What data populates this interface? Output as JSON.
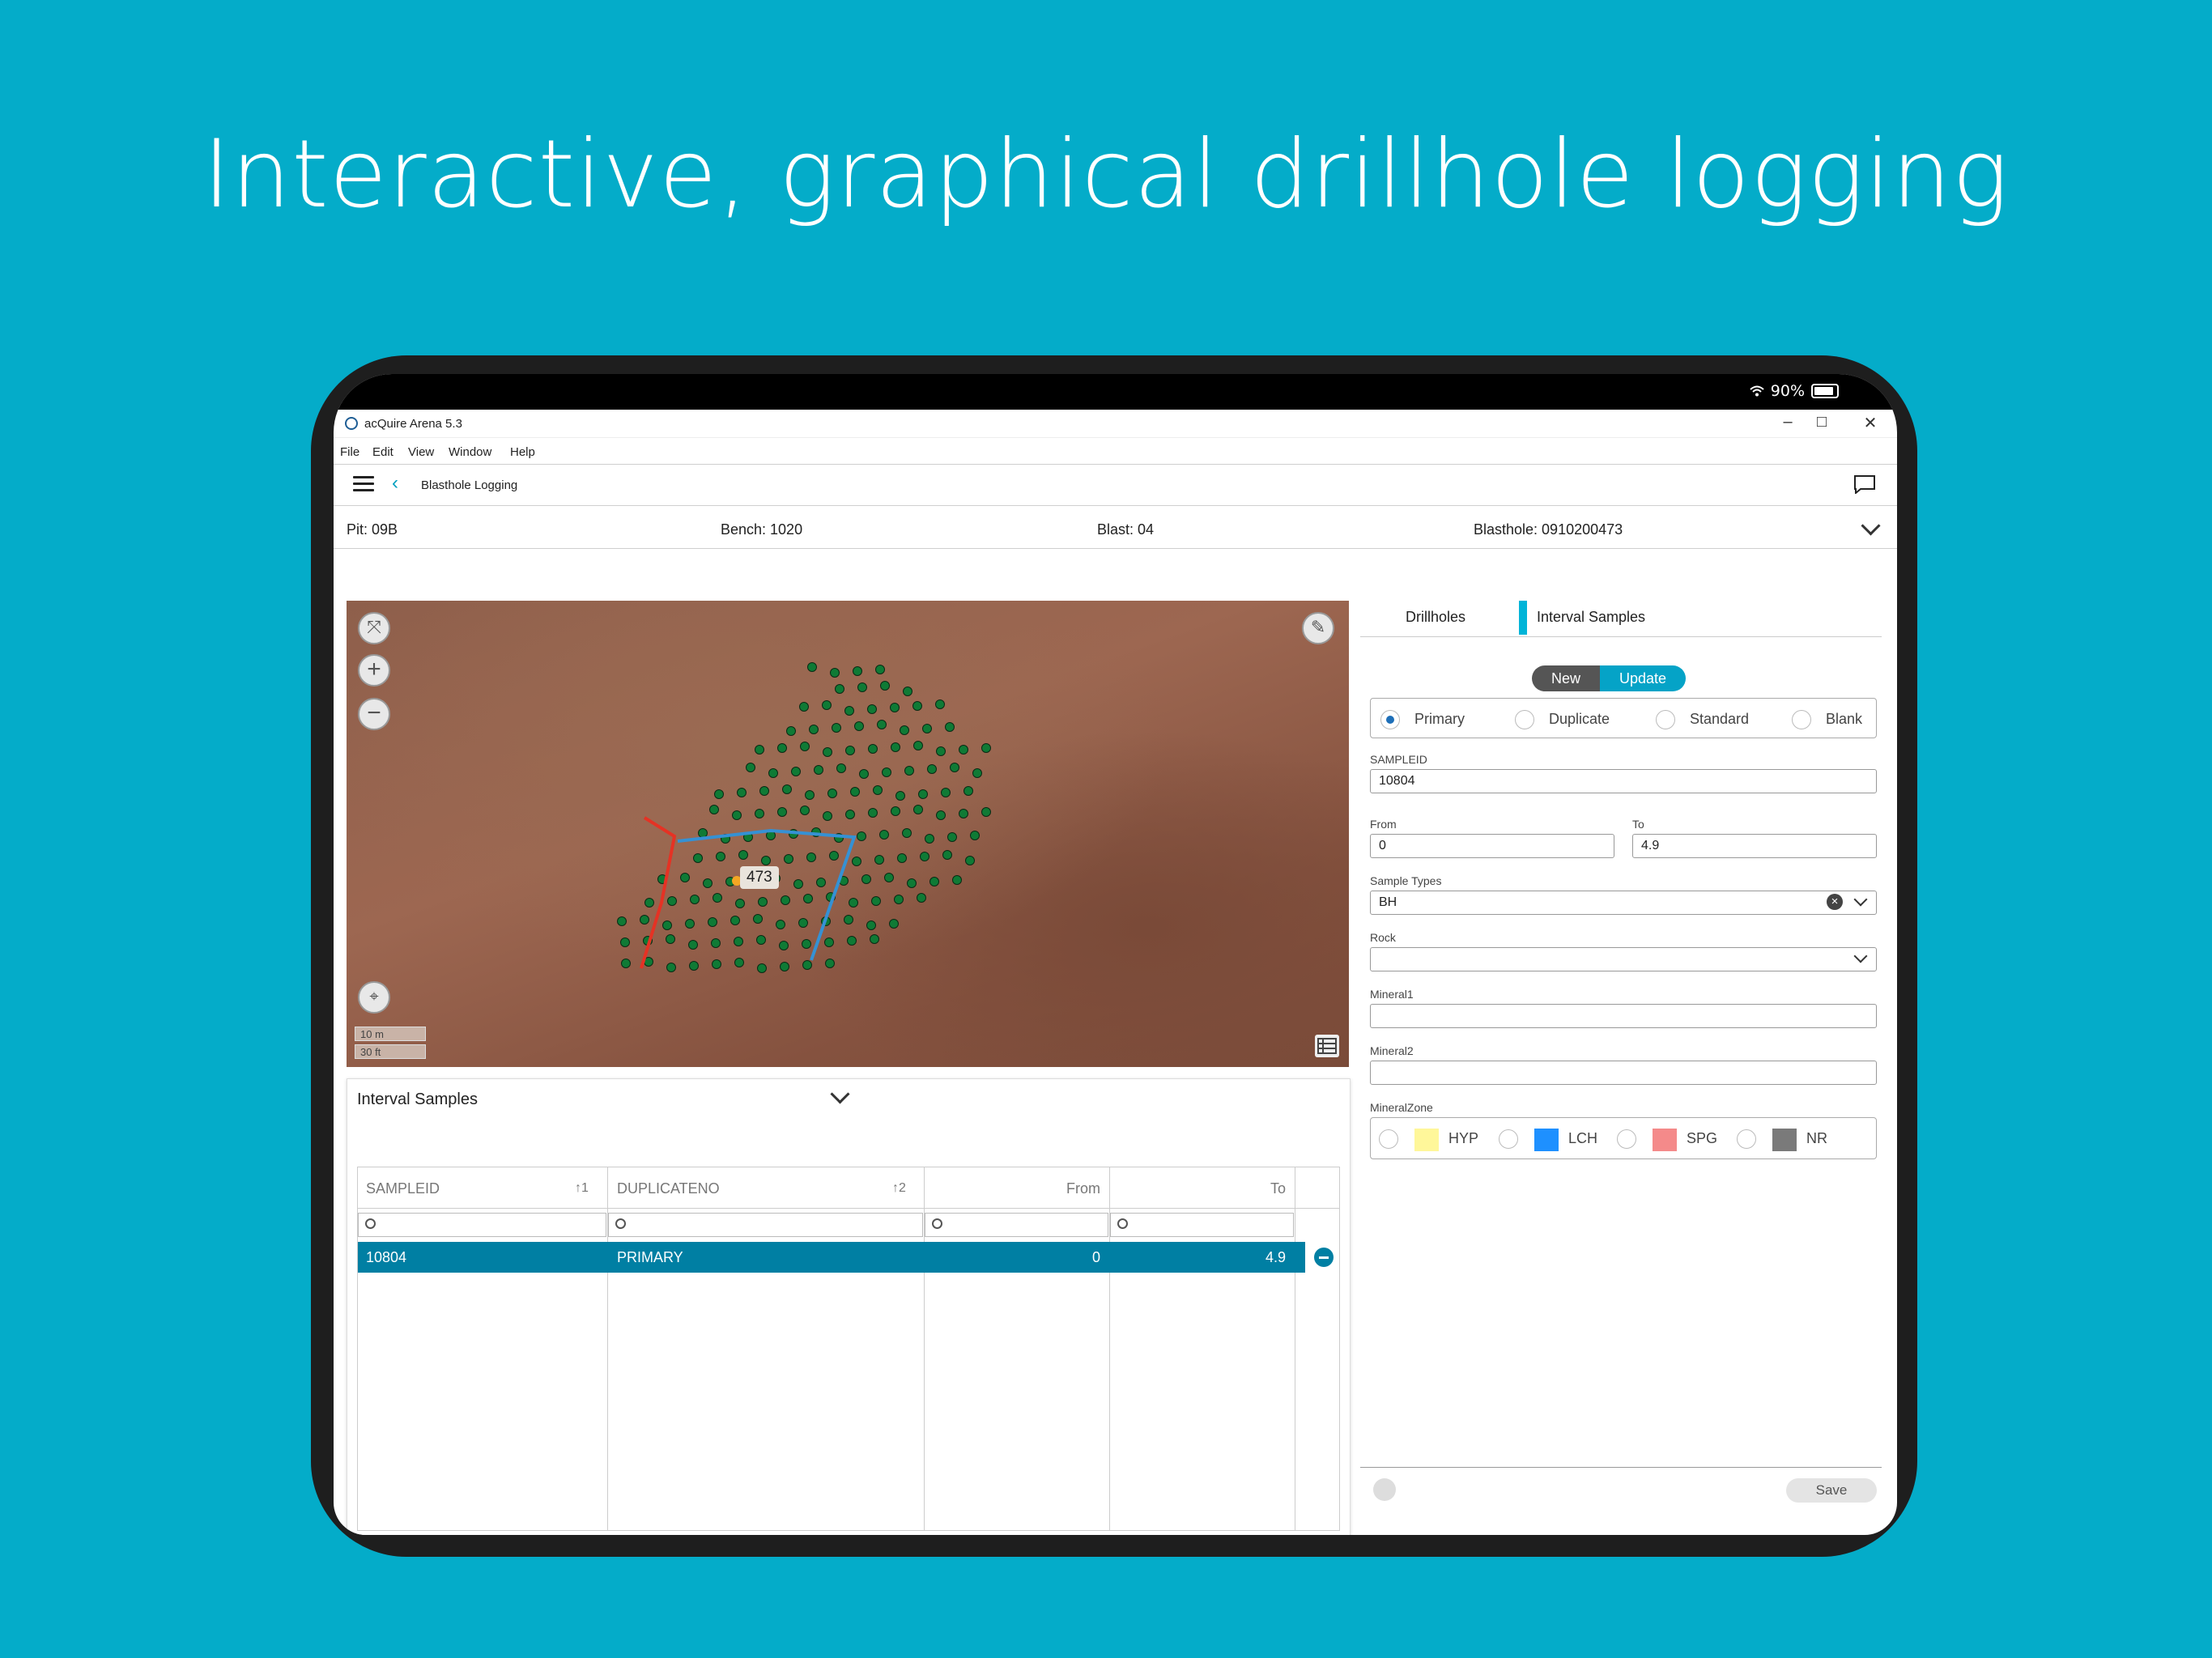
{
  "headline": "Interactive, graphical drillhole logging",
  "device": {
    "battery": "90%"
  },
  "window": {
    "title": "acQuire Arena 5.3",
    "minimize": "–",
    "maximize": "□",
    "close": "✕"
  },
  "menu": {
    "file": "File",
    "edit": "Edit",
    "view": "View",
    "window": "Window",
    "help": "Help"
  },
  "nav": {
    "back": "‹",
    "title": "Blasthole Logging"
  },
  "info": {
    "pit": "Pit: 09B",
    "bench": "Bench: 1020",
    "blast": "Blast: 04",
    "blasthole": "Blasthole: 0910200473"
  },
  "map": {
    "selected_label": "473",
    "scale_m": "10 m",
    "scale_ft": "30 ft",
    "hole_color": "#0f7a35",
    "selected_color": "#f5a623",
    "line_colors": {
      "red": "#e53224",
      "blue": "#3591d4"
    }
  },
  "samples_panel": {
    "title": "Interval Samples",
    "columns": {
      "sampleid": "SAMPLEID",
      "sampleid_sort": "↑1",
      "duplicateno": "DUPLICATENO",
      "duplicateno_sort": "↑2",
      "from": "From",
      "to": "To"
    },
    "row": {
      "sampleid": "10804",
      "duplicateno": "PRIMARY",
      "from": "0",
      "to": "4.9"
    }
  },
  "form": {
    "tabs": {
      "drillholes": "Drillholes",
      "interval_samples": "Interval Samples"
    },
    "mode": {
      "new": "New",
      "update": "Update"
    },
    "sample_kind": {
      "primary": "Primary",
      "duplicate": "Duplicate",
      "standard": "Standard",
      "blank": "Blank",
      "selected": "Primary"
    },
    "sampleid_label": "SAMPLEID",
    "sampleid": "10804",
    "from_label": "From",
    "from": "0",
    "to_label": "To",
    "to": "4.9",
    "sample_types_label": "Sample Types",
    "sample_types": "BH",
    "rock_label": "Rock",
    "rock": "",
    "mineral1_label": "Mineral1",
    "mineral1": "",
    "mineral2_label": "Mineral2",
    "mineral2": "",
    "mineralzone_label": "MineralZone",
    "zones": [
      {
        "code": "HYP",
        "color": "#fff79a"
      },
      {
        "code": "LCH",
        "color": "#1e90ff"
      },
      {
        "code": "SPG",
        "color": "#f48a8a"
      },
      {
        "code": "NR",
        "color": "#7a7a7a"
      }
    ],
    "save": "Save"
  },
  "colors": {
    "background": "#04acc9",
    "accent": "#00a0c0",
    "selected_row": "#007fa3",
    "update_button": "#05a3c7",
    "new_button": "#555555"
  }
}
